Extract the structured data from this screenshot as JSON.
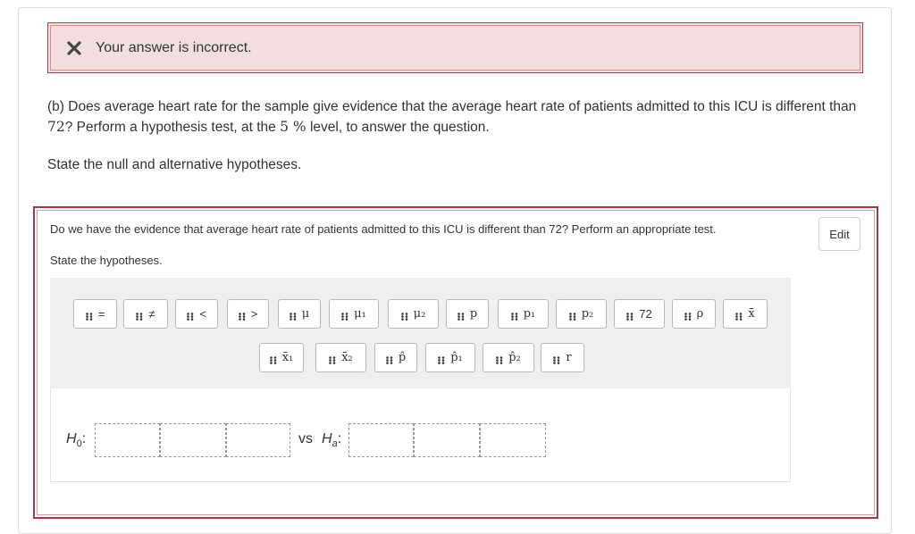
{
  "feedback": {
    "message": "Your answer is incorrect.",
    "icon": "x-mark-icon",
    "icon_color": "#444444",
    "background_color": "#f2dede",
    "border_color": "#b73c4a"
  },
  "question": {
    "text_before_72": "(b) Does average heart rate for the sample give evidence that the average heart rate of patients admitted to this ICU is different than ",
    "value_72": "72",
    "text_mid": "? Perform a hypothesis test, at the ",
    "level_value": "5 %",
    "text_after": " level, to answer the question.",
    "instruction": "State the null and alternative hypotheses."
  },
  "subquestion": {
    "text": "Do we have the evidence that average heart rate of patients admitted to this ICU is different than 72? Perform an appropriate test.",
    "instruction": "State the hypotheses.",
    "edit_label": "Edit",
    "border_color": "#a33a48"
  },
  "palette": {
    "row1": [
      "=",
      "≠",
      "<",
      ">",
      "μ",
      "μ₁",
      "μ₂",
      "p",
      "p₁",
      "p₂",
      "72",
      "ρ",
      "x̄"
    ],
    "row2": [
      "x̄₁",
      "x̄₂",
      "p̂",
      "p̂₁",
      "p̂₂",
      "r"
    ]
  },
  "hypotheses": {
    "null_label": "H",
    "null_sub": "0",
    "vs_label": "vs",
    "alt_label": "H",
    "alt_sub": "a"
  }
}
